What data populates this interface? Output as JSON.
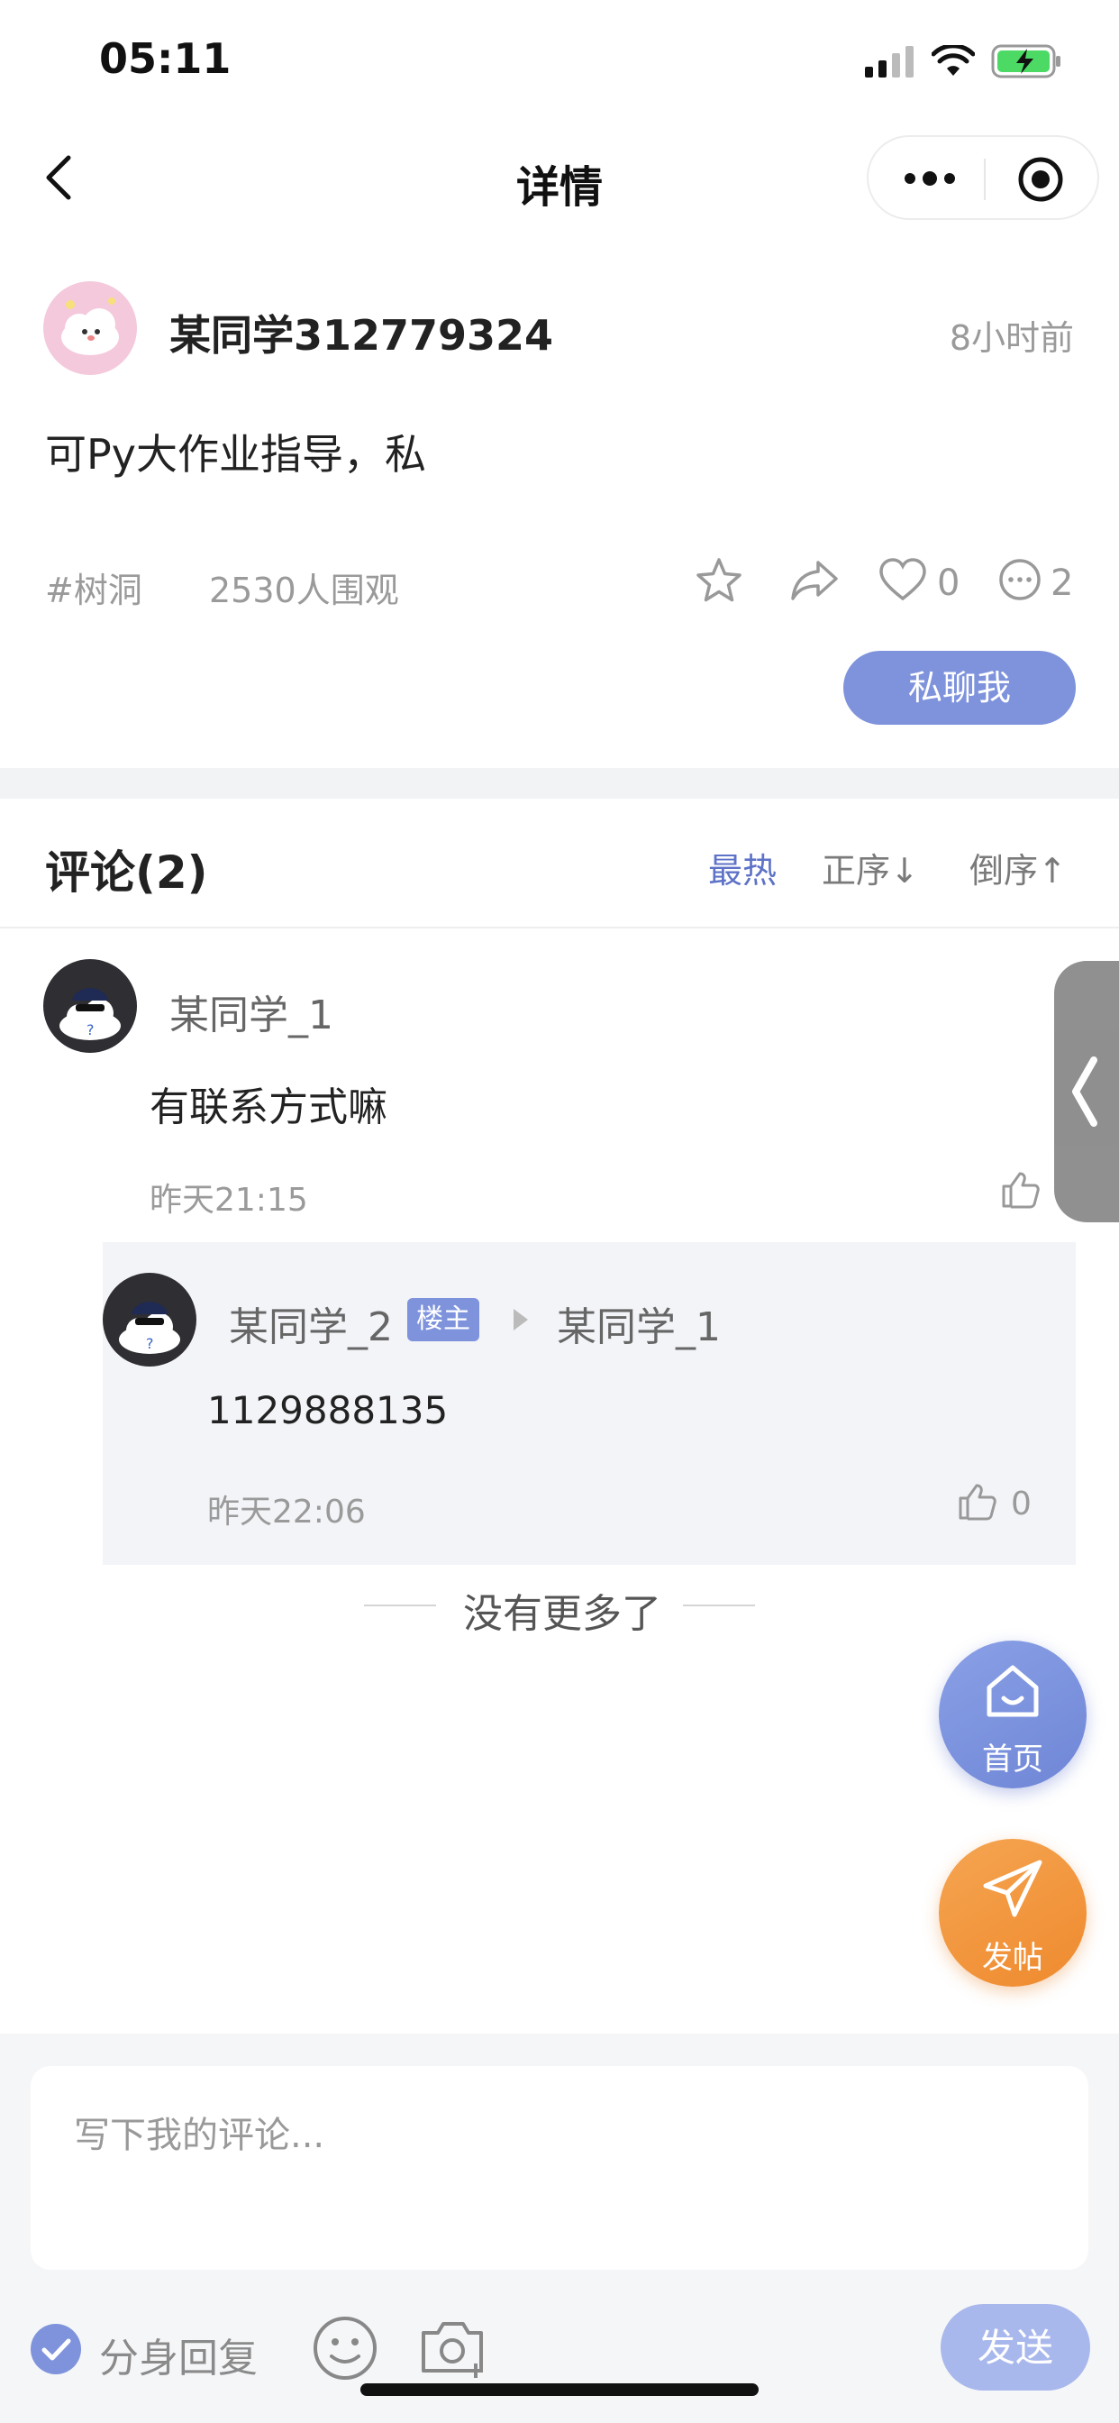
{
  "status_bar": {
    "time": "05:11"
  },
  "nav": {
    "title": "详情"
  },
  "post": {
    "username": "某同学312779324",
    "time": "8小时前",
    "content": "可Py大作业指导，私",
    "tag": "#树洞",
    "views": "2530人围观",
    "like_count": "0",
    "comment_count": "2",
    "private_chat_label": "私聊我"
  },
  "comments": {
    "title": "评论(2)",
    "sort_hot": "最热",
    "sort_asc": "正序↓",
    "sort_desc": "倒序↑",
    "items": [
      {
        "username": "某同学_1",
        "text": "有联系方式嘛",
        "time": "昨天21:15",
        "replies": [
          {
            "username": "某同学_2",
            "badge": "楼主",
            "reply_to": "某同学_1",
            "text": "1129888135",
            "time": "昨天22:06",
            "like_count": "0"
          }
        ]
      }
    ],
    "no_more": "没有更多了"
  },
  "fabs": {
    "home_label": "首页",
    "post_label": "发帖"
  },
  "composer": {
    "placeholder": "写下我的评论...",
    "alt_reply_label": "分身回复",
    "send_label": "发送"
  },
  "colors": {
    "accent": "#7e93dc",
    "orange": "#ef8a2e",
    "text": "#222222",
    "muted": "#9a9a9a"
  }
}
